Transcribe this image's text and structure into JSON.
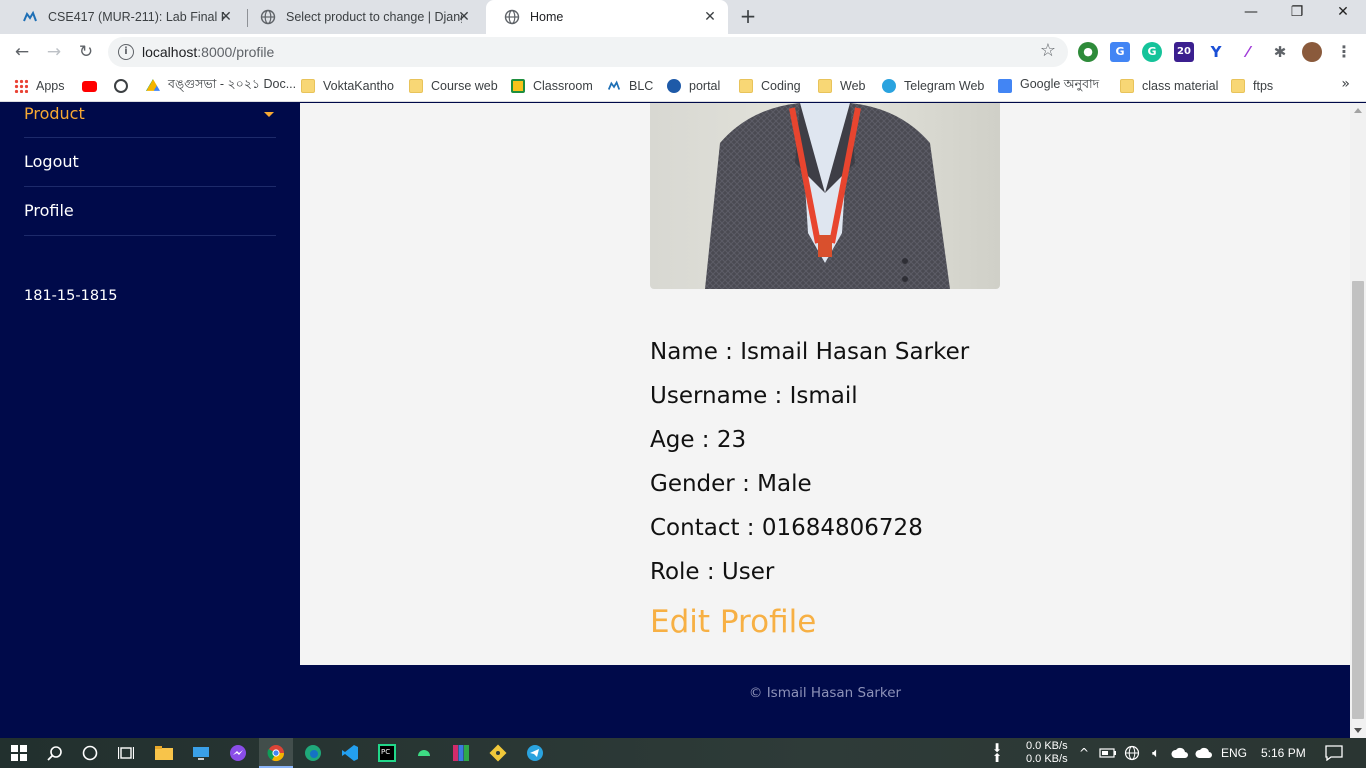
{
  "browser": {
    "tabs": [
      {
        "title": "CSE417 (MUR-211): Lab Final PC-",
        "icon": "moodle-icon"
      },
      {
        "title": "Select product to change | Djang",
        "icon": "globe-icon"
      },
      {
        "title": "Home",
        "icon": "globe-icon",
        "active": true
      }
    ],
    "url_host": "localhost",
    "url_rest": ":8000/profile",
    "extension_badge": "20",
    "bookmarks": [
      {
        "label": "Apps",
        "icon": "apps-grid-icon"
      },
      {
        "label": "",
        "icon": "youtube-icon"
      },
      {
        "label": "",
        "icon": "globe-icon"
      },
      {
        "label": "বঙ্গুসভা - ২০২১ Doc...",
        "icon": "google-drive-icon"
      },
      {
        "label": "VoktaKantho",
        "icon": "folder-icon"
      },
      {
        "label": "Course web",
        "icon": "folder-icon"
      },
      {
        "label": "Classroom",
        "icon": "classroom-icon"
      },
      {
        "label": "BLC",
        "icon": "moodle-icon"
      },
      {
        "label": "portal",
        "icon": "portal-icon"
      },
      {
        "label": "Coding",
        "icon": "folder-icon"
      },
      {
        "label": "Web",
        "icon": "folder-icon"
      },
      {
        "label": "Telegram Web",
        "icon": "telegram-icon"
      },
      {
        "label": "Google অনুবাদ",
        "icon": "google-translate-icon"
      },
      {
        "label": "class material",
        "icon": "folder-icon"
      },
      {
        "label": "ftps",
        "icon": "folder-icon"
      }
    ]
  },
  "sidebar": {
    "items": [
      {
        "label": "Product",
        "active": true
      },
      {
        "label": "Logout"
      },
      {
        "label": "Profile"
      }
    ],
    "student_id": "181-15-1815"
  },
  "profile": {
    "name_line": "Name : Ismail Hasan Sarker",
    "username_line": "Username : Ismail",
    "age_line": "Age : 23",
    "gender_line": "Gender : Male",
    "contact_line": "Contact : 01684806728",
    "role_line": "Role : User",
    "edit_label": "Edit Profile"
  },
  "footer": {
    "copyright": "© Ismail Hasan Sarker"
  },
  "taskbar": {
    "net_down": "0.0 KB/s",
    "net_up": "0.0 KB/s",
    "language": "ENG",
    "time": "5:16 PM"
  },
  "colors": {
    "navy": "#000a4a",
    "accent": "#f7b044",
    "content_bg": "#f4f4f4"
  }
}
